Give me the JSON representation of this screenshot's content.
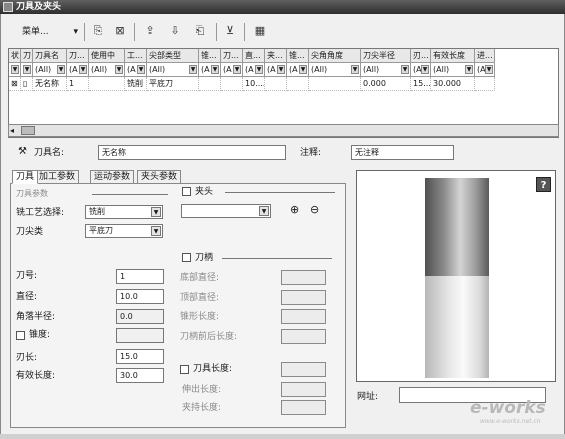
{
  "window": {
    "title": "刀具及夹头"
  },
  "toolbar": {
    "menu_label": "菜单...",
    "menu_arrow": "▾",
    "buttons": [
      {
        "name": "tool-new-icon",
        "glyph": "⎘"
      },
      {
        "name": "tool-delete-icon",
        "glyph": "⊠"
      },
      {
        "name": "tool-import-icon",
        "glyph": "⇪"
      },
      {
        "name": "tool-export-icon",
        "glyph": "⇩"
      },
      {
        "name": "tool-copy-icon",
        "glyph": "⎗"
      },
      {
        "name": "filter-icon",
        "glyph": "⊻"
      },
      {
        "name": "columns-icon",
        "glyph": "▦"
      }
    ]
  },
  "grid": {
    "columns": [
      "状",
      "刀",
      "刀具名",
      "刀...",
      "使用中",
      "工...",
      "尖部类型",
      "锥...",
      "刀...",
      "直...",
      "夹...",
      "锥...",
      "尖角角度",
      "刀尖半径",
      "刃...",
      "有效长度",
      "进..."
    ],
    "filters": [
      "",
      "",
      "(All)",
      "(A",
      "(All)",
      "(A",
      "(All)",
      "(A",
      "(A",
      "(A",
      "(A",
      "(A",
      "(All)",
      "(All)",
      "(A",
      "(All)",
      "(A"
    ],
    "row": [
      "⊠",
      "▯",
      "无名称",
      "1",
      "",
      "铣削",
      "平底刀",
      "",
      "",
      "10....",
      "",
      "",
      "",
      "0.000",
      "15....",
      "30.000",
      ""
    ]
  },
  "name_row": {
    "tool_name_label": "刀具名:",
    "tool_name_value": "无名称",
    "note_label": "注释:",
    "note_value": "无注释"
  },
  "tabs": [
    "刀具",
    "加工参数",
    "运动参数",
    "夹头参数"
  ],
  "tool_panel": {
    "section_label": "刀具参数",
    "process_label": "铣工艺选择:",
    "process_value": "铣削",
    "type_label": "刀尖类",
    "type_value": "平底刀",
    "number_label": "刀号:",
    "number_value": "1",
    "diameter_label": "直径:",
    "diameter_value": "10.0",
    "corner_label": "角落半径:",
    "corner_value": "0.0",
    "taper_label": "锥度:",
    "taper_value": "",
    "flute_label": "刃长:",
    "flute_value": "15.0",
    "effective_label": "有效长度:",
    "effective_value": "30.0"
  },
  "holder_panel": {
    "collet_label": "夹头",
    "collet_value": "",
    "shank_label": "刀柄",
    "bottom_dia_label": "底部直径:",
    "top_dia_label": "顶部直径:",
    "taper_len_label": "锥形长度:",
    "shank_len_label": "刀柄前后长度:",
    "tool_length_label": "刀具长度:",
    "exposed_label": "伸出长度:",
    "holder_len_label": "夹持长度:"
  },
  "preview": {
    "help_label": "?",
    "url_label": "网址:",
    "url_value": ""
  },
  "watermark": {
    "text": "e-works",
    "sub": "www.e-works.net.cn"
  }
}
